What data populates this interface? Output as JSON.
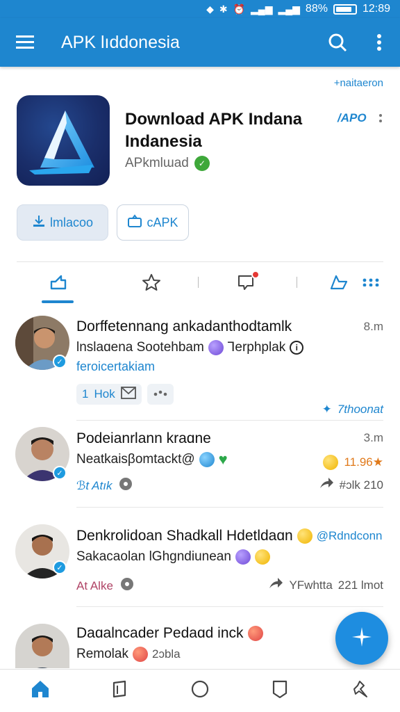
{
  "status_bar": {
    "battery": "88%",
    "time": "12:89"
  },
  "app_bar": {
    "title": "APK lıddonesia"
  },
  "promo_link": "+naitaeron",
  "app": {
    "headline_line1": "Download APK Indana",
    "headline_line2": "Indanesia",
    "publisher": "APkmlɯad",
    "tag": "/APO"
  },
  "buttons": {
    "install": "lmlacoo",
    "apk": "cAPK"
  },
  "feed": [
    {
      "title": "Dorffetennang ankadanthodtamlk",
      "subtitle": "lnslaɑena Sootehbam",
      "subtitle_tail": "Ꞁerphplak",
      "time": "8.m",
      "link": "feroicertakiam",
      "chip_label": "Hok",
      "chip_prefix": "1",
      "action": "7thoonat"
    },
    {
      "title": "Podeianrlann kraɑne",
      "subtitle": "Neatkaisβomtackt@",
      "time": "3.m",
      "meta_label": "ℬt Atık",
      "share_text": "#ɔlk 210",
      "reactions": "11.96★"
    },
    {
      "title": "Denkrolidoan Shadkall Hdetldaɑn",
      "title_tail": "@Rdndconn",
      "subtitle": "Sakacaolan lGhgndiunean",
      "meta_label": "At Alke",
      "share_text": "YFwhtta",
      "share_count": "221 lmot"
    },
    {
      "title": "Daɑalncader Pedaɑd inck",
      "subtitle": "Remolak",
      "subtitle_tail": "2ɔbla"
    }
  ],
  "colors": {
    "primary": "#1e86cf",
    "fab": "#1e8de0",
    "badge_green": "#3ea83a",
    "notif_red": "#e53935"
  }
}
